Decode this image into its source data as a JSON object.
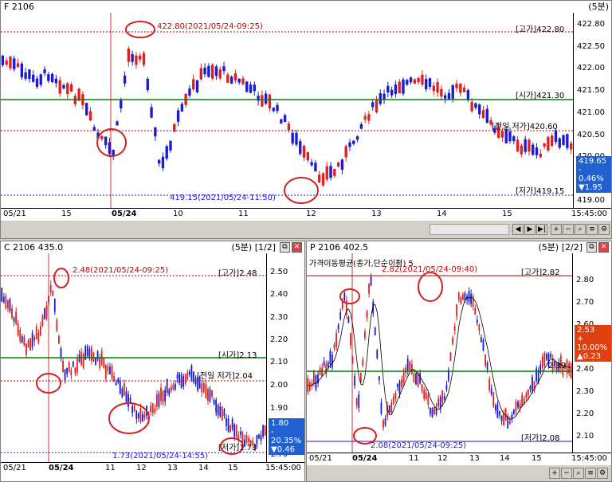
{
  "main": {
    "title": "F 2106",
    "period": "(5분)",
    "high_marker": "422.80(2021/05/24-09:25)",
    "low_marker": "419.15(2021/05/24-11:50)",
    "ref_high": "[고가]422.80",
    "ref_open": "[시가]421.30",
    "ref_prev_low": "[전일 저가]420.60",
    "ref_low": "[저가]419.15",
    "yticks": [
      "422.80",
      "422.50",
      "422.00",
      "421.50",
      "421.00",
      "420.50",
      "420.00",
      "419.50",
      "419.00"
    ],
    "xticks": [
      "05/21",
      "15",
      "05/24",
      "10",
      "11",
      "12",
      "13",
      "14",
      "15",
      "15:45:00"
    ],
    "price_box": {
      "price": "419.65",
      "pct": "- 0.46%",
      "chg": "▼1.95"
    },
    "colors": {
      "price_box": "#2060d0"
    }
  },
  "left": {
    "title": "C 2106 435.0",
    "period": "(5분) [1/2]",
    "high_marker": "2.48(2021/05/24-09:25)",
    "low_marker": "1.73(2021/05/24-14:55)",
    "ref_high": "[고가]2.48",
    "ref_open": "[시가]2.13",
    "ref_prev_low": "[전일 저가]2.04",
    "ref_low": "[저가]1.73",
    "yticks": [
      "2.50",
      "2.40",
      "2.30",
      "2.20",
      "2.10",
      "2.00",
      "1.90",
      "1.80",
      "1.70"
    ],
    "xticks": [
      "05/21",
      "05/24",
      "11",
      "12",
      "13",
      "14",
      "15",
      "15:45:00"
    ],
    "price_box": {
      "price": "1.80",
      "pct": "- 20.35%",
      "chg": "▼0.46"
    },
    "colors": {
      "price_box": "#2060d0"
    }
  },
  "right": {
    "title": "P 2106 402.5",
    "period": "(5분) [2/2]",
    "indicator": "가격이동평균(종가,단순이평) 5",
    "high_marker": "2.82(2021/05/24-09:40)",
    "low_marker": "2.08(2021/05/24-09:25)",
    "ref_high": "[고가]2.82",
    "ref_low": "[저가]2.08",
    "ma_value": "2.39",
    "yticks": [
      "2.80",
      "2.70",
      "2.60",
      "2.50",
      "2.40",
      "2.30",
      "2.20",
      "2.10"
    ],
    "xticks": [
      "05/21",
      "05/24",
      "11",
      "12",
      "13",
      "14",
      "15",
      "15:45:00"
    ],
    "price_box": {
      "price": "2.53",
      "pct": "+ 10.00%",
      "chg": "▲0.23"
    },
    "colors": {
      "price_box": "#e04010"
    }
  }
}
